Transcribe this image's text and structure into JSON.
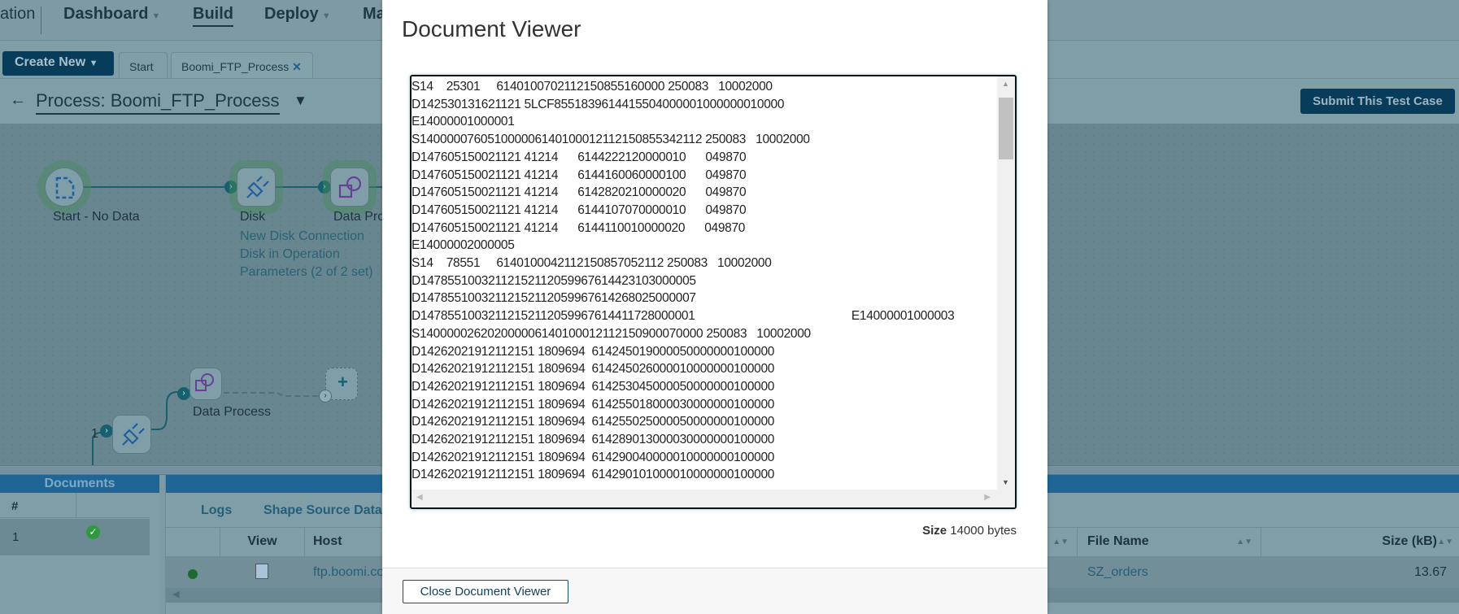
{
  "nav": {
    "items": [
      {
        "label": "ation"
      },
      {
        "label": "Dashboard"
      },
      {
        "label": "Build"
      },
      {
        "label": "Deploy"
      },
      {
        "label": "Ma"
      }
    ]
  },
  "toolbar": {
    "create_new": "Create New",
    "tabs": [
      {
        "label": "Start"
      },
      {
        "label": "Boomi_FTP_Process"
      }
    ],
    "process_title": "Process: Boomi_FTP_Process",
    "submit": "Submit This Test Case"
  },
  "canvas": {
    "start": {
      "label": "Start - No Data"
    },
    "disk": {
      "label": "Disk",
      "details": [
        "New Disk Connection",
        "Disk in Operation",
        "Parameters (2 of 2 set)"
      ]
    },
    "data_process": {
      "label": "Data Pro"
    },
    "branch_number": "1",
    "data_process_2": {
      "label": "Data Process"
    }
  },
  "documents": {
    "title": "Documents",
    "header": "#",
    "rows": [
      {
        "num": "1",
        "status": "success"
      }
    ]
  },
  "results": {
    "tabs": [
      "Logs",
      "Shape Source Data"
    ],
    "columns": [
      "View",
      "Host",
      "File Name",
      "Size (kB)"
    ],
    "row": {
      "status": "green",
      "host": "ftp.boomi.co",
      "file_name": "SZ_orders",
      "size": "13.67"
    }
  },
  "document_viewer": {
    "title": "Document Viewer",
    "lines": [
      "S14    25301     6140100702112150855160000 250083   10002000",
      "D142530131621121 5LCF8551839614415504000001000000010000",
      "E14000001000001",
      "S140000076051000006140100012112150855342112 250083   10002000",
      "D147605150021121 41214      6144222120000010      049870",
      "D147605150021121 41214      6144160060000100      049870",
      "D147605150021121 41214      6142820210000020      049870",
      "D147605150021121 41214      6144107070000010      049870",
      "D147605150021121 41214      6144110010000020      049870",
      "E14000002000005",
      "S14    78551     6140100042112150857052112 250083   10002000",
      "D14785510032112152112059967614423103000005",
      "D14785510032112152112059967614268025000007",
      "D14785510032112152112059967614411728000001                                                E14000001000003",
      "S140000026202000006140100012112150900070000 250083   10002000",
      "D14262021912112151 1809694  614245019000050000000100000",
      "D14262021912112151 1809694  614245026000010000000100000",
      "D14262021912112151 1809694  614253045000050000000100000",
      "D14262021912112151 1809694  614255018000030000000100000",
      "D14262021912112151 1809694  614255025000050000000100000",
      "D14262021912112151 1809694  614289013000030000000100000",
      "D14262021912112151 1809694  614290040000010000000100000",
      "D14262021912112151 1809694  614290101000010000000100000"
    ],
    "size_label": "Size",
    "size_value": "14000 bytes",
    "close": "Close Document Viewer"
  }
}
